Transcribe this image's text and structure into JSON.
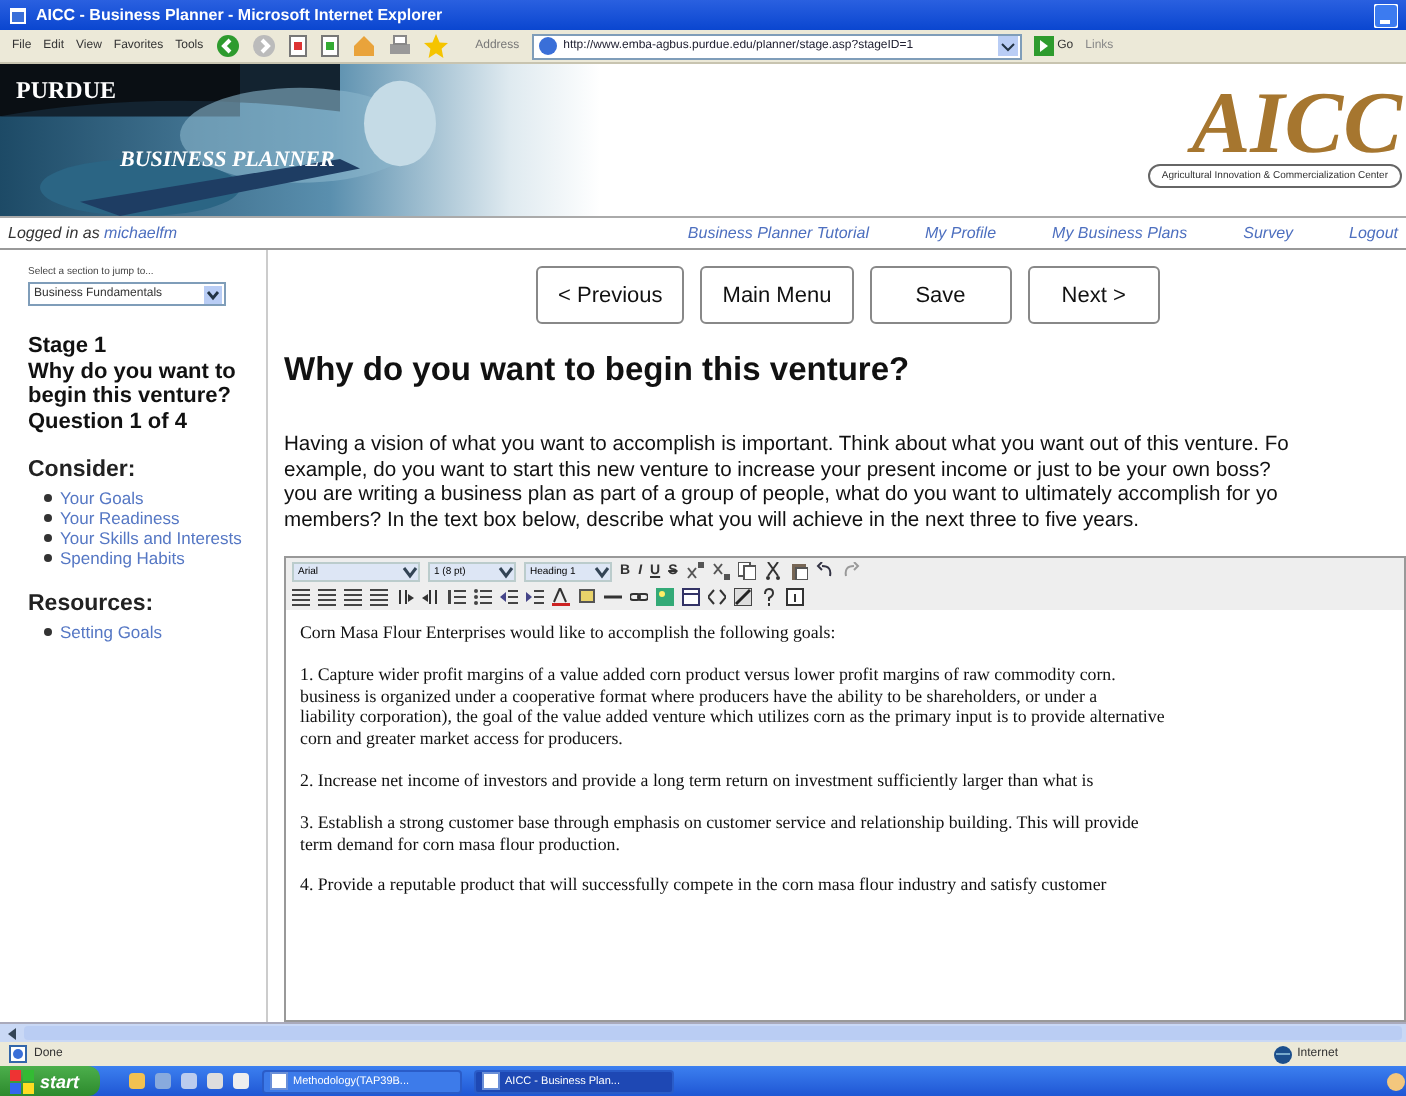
{
  "window": {
    "title": "AICC - Business Planner - Microsoft Internet Explorer"
  },
  "menu": [
    "File",
    "Edit",
    "View",
    "Favorites",
    "Tools"
  ],
  "address": {
    "label": "Address",
    "value": "http://www.emba-agbus.purdue.edu/planner/stage.asp?stageID=1",
    "go": "Go",
    "links": "Links"
  },
  "banner": {
    "university": "PURDUE",
    "product": "BUSINESS PLANNER",
    "logo": "AICC",
    "logo_caption": "Agricultural Innovation & Commercialization Center"
  },
  "userbar": {
    "prefix": "Logged in as",
    "user": "michaelfm",
    "links": [
      "Business Planner Tutorial",
      "My Profile",
      "My Business Plans",
      "Survey",
      "Logout"
    ]
  },
  "sidebar": {
    "jump_label": "Select a section to jump to...",
    "jump_value": "Business Fundamentals",
    "stage": "Stage 1",
    "stage_title": "Why do you want to begin this venture?",
    "question": "Question 1 of 4",
    "consider_heading": "Consider:",
    "consider": [
      "Your Goals",
      "Your Readiness",
      "Your Skills and Interests",
      "Spending Habits"
    ],
    "resources_heading": "Resources:",
    "resources": [
      "Setting Goals"
    ]
  },
  "nav_buttons": [
    "< Previous",
    "Main Menu",
    "Save",
    "Next >"
  ],
  "heading": "Why do you want to begin this venture?",
  "intro_lines": [
    "Having a vision of what you want to accomplish is important. Think about what you want out of this venture. Fo",
    "example, do you want to start this new venture to increase your present income or just to be your own boss?",
    "you are writing a business plan as part of a group of people, what do you want to ultimately accomplish for yo",
    "members? In the text box below, describe what you will achieve in the next three to five years."
  ],
  "editor": {
    "font": "Arial",
    "size": "1 (8 pt)",
    "style": "Heading 1",
    "format_buttons": [
      "B",
      "I",
      "U",
      "S"
    ],
    "paragraphs": [
      [
        "Corn Masa Flour Enterprises would like to accomplish the following goals:"
      ],
      [
        "1. Capture wider profit margins of a value added corn product versus lower profit margins of raw commodity corn.",
        "business is organized under a cooperative format where producers have the ability to be shareholders, or under a",
        "liability corporation), the goal of the value added venture which utilizes corn as the primary input is to provide alternative",
        "corn and greater market access for producers."
      ],
      [
        "2. Increase net income of investors and provide a long term return on investment sufficiently larger than what is"
      ],
      [
        "3. Establish a strong customer base through emphasis on customer service and relationship building.  This will provide",
        "term demand for corn masa flour production."
      ],
      [
        "4.  Provide a reputable product that will successfully compete in the corn masa flour industry and satisfy customer"
      ]
    ]
  },
  "status_bar": {
    "text": "Done",
    "zone": "Internet"
  },
  "taskbar": {
    "start": "start",
    "windows": [
      {
        "label": "Methodology(TAP39B...",
        "selected": false
      },
      {
        "label": "AICC - Business Plan...",
        "selected": true
      }
    ]
  }
}
